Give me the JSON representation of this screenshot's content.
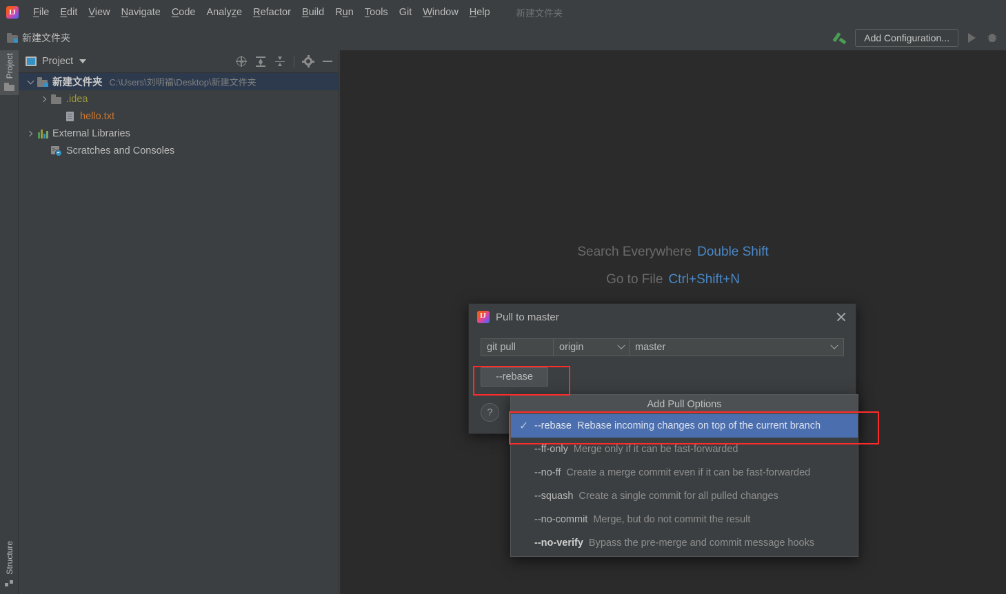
{
  "app": {
    "logo_icon": "intellij-logo-icon",
    "window_project_name": "新建文件夹"
  },
  "menubar": {
    "items": [
      {
        "label": "File",
        "mnemonic": "F"
      },
      {
        "label": "Edit",
        "mnemonic": "E"
      },
      {
        "label": "View",
        "mnemonic": "V"
      },
      {
        "label": "Navigate",
        "mnemonic": "N"
      },
      {
        "label": "Code",
        "mnemonic": "C"
      },
      {
        "label": "Analyze",
        "mnemonic": "z"
      },
      {
        "label": "Refactor",
        "mnemonic": "R"
      },
      {
        "label": "Build",
        "mnemonic": "B"
      },
      {
        "label": "Run",
        "mnemonic": "u"
      },
      {
        "label": "Tools",
        "mnemonic": "T"
      },
      {
        "label": "Git",
        "mnemonic": ""
      },
      {
        "label": "Window",
        "mnemonic": "W"
      },
      {
        "label": "Help",
        "mnemonic": "H"
      }
    ]
  },
  "navbar": {
    "breadcrumb": "新建文件夹",
    "breadcrumb_icon": "folder-module-icon",
    "build_icon": "hammer-build-icon",
    "add_configuration_label": "Add Configuration...",
    "run_icon": "run-triangle-icon",
    "debug_icon": "debug-bug-icon"
  },
  "rail": {
    "project_label": "Project",
    "project_icon": "folder-icon",
    "structure_label": "Structure",
    "structure_icon": "structure-icon"
  },
  "toolwindow": {
    "title": "Project",
    "title_icon": "project-view-icon",
    "dropdown_icon": "chevron-down-icon",
    "actions": [
      {
        "name": "select-opened-file-icon",
        "tooltip": "Select Opened File"
      },
      {
        "name": "expand-all-icon",
        "tooltip": "Expand All"
      },
      {
        "name": "collapse-all-icon",
        "tooltip": "Collapse All"
      },
      {
        "name": "settings-gear-icon",
        "tooltip": "Settings"
      },
      {
        "name": "hide-icon",
        "tooltip": "Hide"
      }
    ],
    "tree": [
      {
        "label": "新建文件夹",
        "path": "C:\\Users\\刘明福\\Desktop\\新建文件夹",
        "icon": "project-folder-icon",
        "twisty": "expanded",
        "indent": 0,
        "selected": true,
        "bold": true,
        "color": "#c9c9c9"
      },
      {
        "label": ".idea",
        "path": "",
        "icon": "folder-icon",
        "twisty": "collapsed",
        "indent": 1,
        "selected": false,
        "bold": false,
        "color": "#9a9a3a"
      },
      {
        "label": "hello.txt",
        "path": "",
        "icon": "text-file-icon",
        "twisty": "none",
        "indent": 2,
        "selected": false,
        "bold": false,
        "color": "#cc7832"
      },
      {
        "label": "External Libraries",
        "path": "",
        "icon": "libraries-icon",
        "twisty": "collapsed",
        "indent": 0,
        "selected": false,
        "bold": false,
        "color": "#bbbbbb"
      },
      {
        "label": "Scratches and Consoles",
        "path": "",
        "icon": "scratches-icon",
        "twisty": "none",
        "indent": 1,
        "selected": false,
        "bold": false,
        "color": "#bbbbbb"
      }
    ]
  },
  "editor": {
    "hints": [
      {
        "label": "Search Everywhere",
        "key": "Double Shift"
      },
      {
        "label": "Go to File",
        "key": "Ctrl+Shift+N"
      }
    ]
  },
  "dialog": {
    "title": "Pull to master",
    "icon": "intellij-logo-icon",
    "close_icon": "close-icon",
    "command_field": "git pull",
    "remote_value": "origin",
    "remote_chevron_icon": "chevron-down-icon",
    "branch_value": "master",
    "branch_chevron_icon": "chevron-down-icon",
    "option_chip": "--rebase",
    "help_label": "?",
    "help_icon": "help-icon"
  },
  "popup": {
    "header": "Add Pull Options",
    "items": [
      {
        "flag": "--rebase",
        "description": "Rebase incoming changes on top of the current branch",
        "checked": true,
        "check_icon": "checkmark-icon",
        "selected": true,
        "bold_flag": false
      },
      {
        "flag": "--ff-only",
        "description": "Merge only if it can be fast-forwarded",
        "checked": false,
        "check_icon": "",
        "selected": false,
        "bold_flag": false
      },
      {
        "flag": "--no-ff",
        "description": "Create a merge commit even if it can be fast-forwarded",
        "checked": false,
        "check_icon": "",
        "selected": false,
        "bold_flag": false
      },
      {
        "flag": "--squash",
        "description": "Create a single commit for all pulled changes",
        "checked": false,
        "check_icon": "",
        "selected": false,
        "bold_flag": false
      },
      {
        "flag": "--no-commit",
        "description": "Merge, but do not commit the result",
        "checked": false,
        "check_icon": "",
        "selected": false,
        "bold_flag": false
      },
      {
        "flag": "--no-verify",
        "description": "Bypass the pre-merge and commit message hooks",
        "checked": false,
        "check_icon": "",
        "selected": false,
        "bold_flag": true
      }
    ]
  },
  "annotations": {
    "highlight_color": "#ff2b2b",
    "chip_highlight": "--rebase option chip",
    "item_highlight": "--rebase popup menu item"
  },
  "colors": {
    "window_bg": "#3c3f41",
    "editor_bg": "#2b2b2b",
    "selection_blue": "#4b6eaf",
    "tree_selection": "#2d3a4d",
    "text": "#bbbbbb",
    "muted_text": "#808080",
    "link_blue": "#4a88c7",
    "accent_green": "#499c54"
  }
}
